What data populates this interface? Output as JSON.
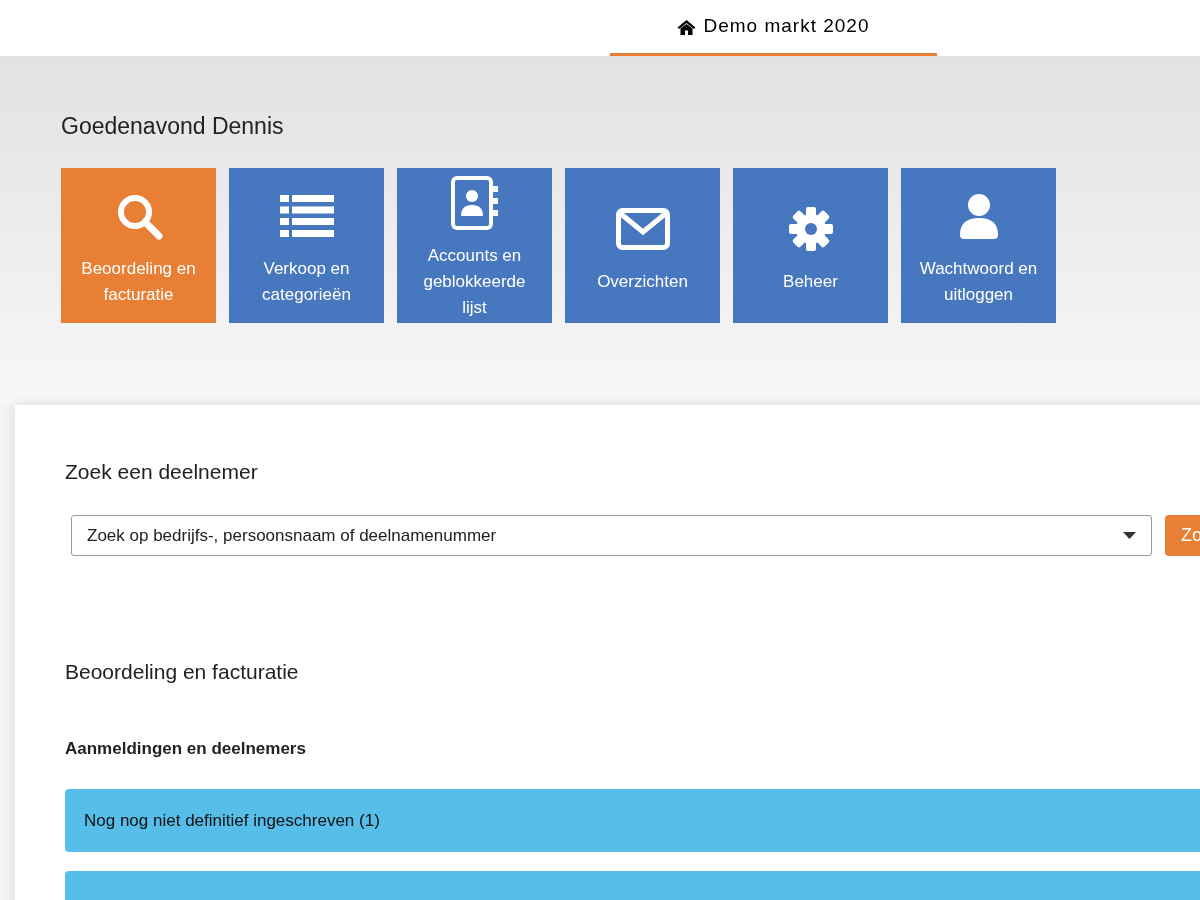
{
  "header": {
    "title": "Demo markt 2020"
  },
  "greeting": "Goedenavond Dennis",
  "tiles": [
    {
      "kind": "search",
      "label": "Beoordeling en facturatie",
      "selected": true
    },
    {
      "kind": "list",
      "label": "Verkoop en categorieën",
      "selected": false
    },
    {
      "kind": "contacts",
      "label": "Accounts en geblokkeerde lijst",
      "selected": false
    },
    {
      "kind": "mail",
      "label": "Overzichten",
      "selected": false
    },
    {
      "kind": "gear",
      "label": "Beheer",
      "selected": false
    },
    {
      "kind": "user",
      "label": "Wachtwoord en uitloggen",
      "selected": false
    }
  ],
  "search": {
    "heading": "Zoek een deelnemer",
    "placeholder": "Zoek op bedrijfs-, persoonsnaam of deelnamenummer",
    "button": "Zo"
  },
  "section": {
    "heading": "Beoordeling en facturatie",
    "subheading": "Aanmeldingen en deelnemers",
    "panels": [
      {
        "kind": "labeled",
        "label": "Nog nog niet definitief ingeschreven (1)"
      },
      {
        "kind": "cut"
      }
    ]
  }
}
